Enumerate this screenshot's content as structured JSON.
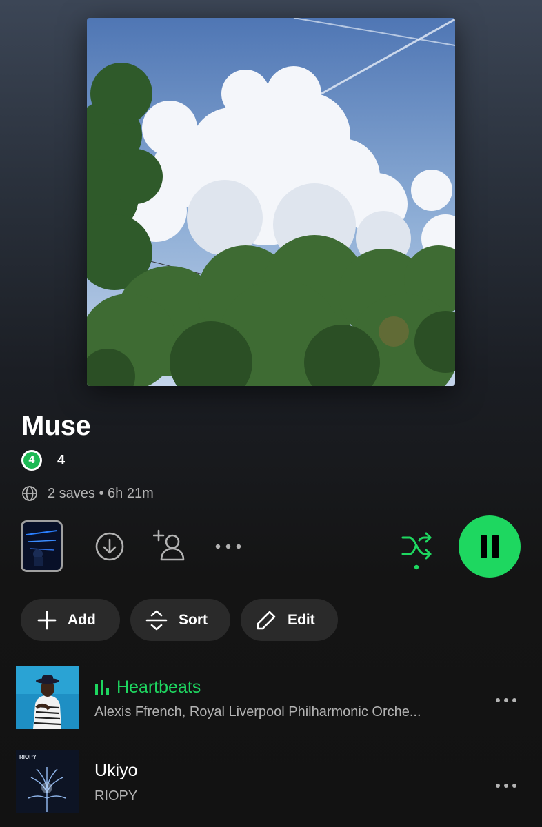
{
  "playlist": {
    "title": "Muse",
    "owner_avatar_text": "4",
    "owner_name": "4",
    "meta": "2 saves • 6h 21m"
  },
  "actions": {
    "add_label": "Add",
    "sort_label": "Sort",
    "edit_label": "Edit"
  },
  "tracks": [
    {
      "title": "Heartbeats",
      "artist": "Alexis Ffrench, Royal Liverpool Philharmonic Orche...",
      "playing": true
    },
    {
      "title": "Ukiyo",
      "artist": "RIOPY",
      "playing": false,
      "art_text": "RIOPY"
    }
  ],
  "colors": {
    "accent": "#1ed760",
    "background": "#121212",
    "secondary_text": "#b3b3b3",
    "pill": "#2a2a2a"
  },
  "icons": [
    "globe-icon",
    "download-icon",
    "add-user-icon",
    "more-icon",
    "shuffle-icon",
    "pause-icon",
    "plus-icon",
    "sort-icon",
    "pencil-icon",
    "equalizer-icon"
  ]
}
